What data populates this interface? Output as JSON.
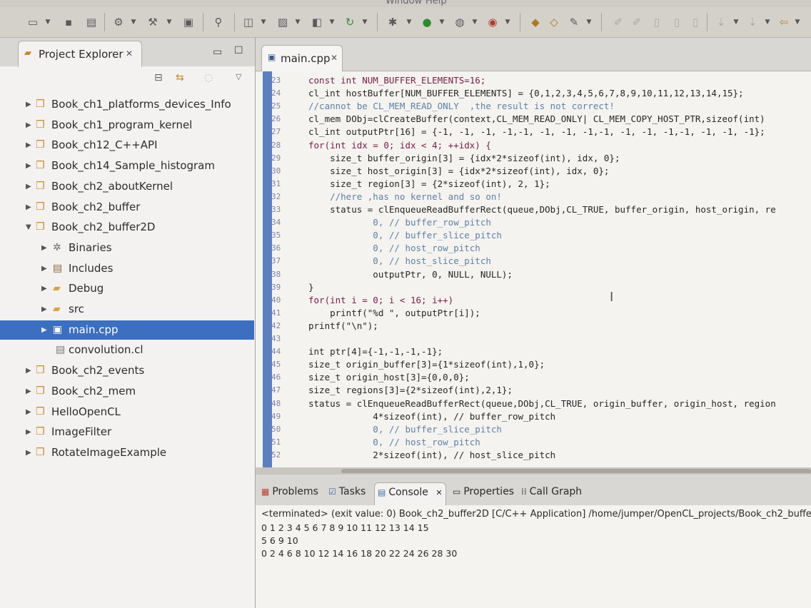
{
  "menubar": {
    "items": [
      "Window",
      "Help"
    ]
  },
  "toolbar": {
    "icons": [
      "new-icon",
      "save-icon",
      "print-icon",
      "build-icon",
      "hammer-icon",
      "binary-icon",
      "search-icon",
      "new-class-icon",
      "new-folder-icon",
      "new-source-icon",
      "refresh-icon",
      "debug-icon",
      "run-icon",
      "profile-icon",
      "external-tools-icon",
      "open-folder-icon",
      "open-type-icon",
      "edit-icon",
      "annotation-icon",
      "prev-icon",
      "next-icon"
    ]
  },
  "project_explorer": {
    "title": "Project Explorer",
    "tree": [
      {
        "label": "Book_ch1_platforms_devices_Info",
        "level": 0,
        "expanded": false,
        "icon": "project-icon"
      },
      {
        "label": "Book_ch1_program_kernel",
        "level": 0,
        "expanded": false,
        "icon": "project-icon"
      },
      {
        "label": "Book_ch12_C++API",
        "level": 0,
        "expanded": false,
        "icon": "project-icon"
      },
      {
        "label": "Book_ch14_Sample_histogram",
        "level": 0,
        "expanded": false,
        "icon": "project-icon"
      },
      {
        "label": "Book_ch2_aboutKernel",
        "level": 0,
        "expanded": false,
        "icon": "project-icon"
      },
      {
        "label": "Book_ch2_buffer",
        "level": 0,
        "expanded": false,
        "icon": "project-icon"
      },
      {
        "label": "Book_ch2_buffer2D",
        "level": 0,
        "expanded": true,
        "icon": "project-icon"
      },
      {
        "label": "Binaries",
        "level": 1,
        "expanded": false,
        "icon": "binaries-icon"
      },
      {
        "label": "Includes",
        "level": 1,
        "expanded": false,
        "icon": "includes-icon"
      },
      {
        "label": "Debug",
        "level": 1,
        "expanded": false,
        "icon": "folder-icon"
      },
      {
        "label": "src",
        "level": 1,
        "expanded": false,
        "icon": "folder-icon"
      },
      {
        "label": "main.cpp",
        "level": 1,
        "expanded": false,
        "icon": "cpp-file-icon",
        "selected": true
      },
      {
        "label": "convolution.cl",
        "level": 1,
        "icon": "file-icon"
      },
      {
        "label": "Book_ch2_events",
        "level": 0,
        "expanded": false,
        "icon": "project-icon"
      },
      {
        "label": "Book_ch2_mem",
        "level": 0,
        "expanded": false,
        "icon": "project-icon"
      },
      {
        "label": "HelloOpenCL",
        "level": 0,
        "expanded": false,
        "icon": "project-icon"
      },
      {
        "label": "ImageFilter",
        "level": 0,
        "expanded": false,
        "icon": "project-icon"
      },
      {
        "label": "RotateImageExample",
        "level": 0,
        "expanded": false,
        "icon": "project-icon"
      }
    ]
  },
  "editor": {
    "tab_label": "main.cpp",
    "lines": [
      {
        "n": "23",
        "text": "const int NUM_BUFFER_ELEMENTS=16;",
        "style": "kw"
      },
      {
        "n": "24",
        "text": "cl_int hostBuffer[NUM_BUFFER_ELEMENTS] = {0,1,2,3,4,5,6,7,8,9,10,11,12,13,14,15};",
        "style": ""
      },
      {
        "n": "25",
        "text": "//cannot be CL_MEM_READ_ONLY  ,the result is not correct!",
        "style": "comment"
      },
      {
        "n": "26",
        "text": "cl_mem DObj=clCreateBuffer(context,CL_MEM_READ_ONLY| CL_MEM_COPY_HOST_PTR,sizeof(int)",
        "style": ""
      },
      {
        "n": "27",
        "text": "cl_int outputPtr[16] = {-1, -1, -1, -1,-1, -1, -1, -1,-1, -1, -1, -1,-1, -1, -1, -1};",
        "style": ""
      },
      {
        "n": "28",
        "text": "for(int idx = 0; idx < 4; ++idx) {",
        "style": "kw"
      },
      {
        "n": "29",
        "text": "    size_t buffer_origin[3] = {idx*2*sizeof(int), idx, 0};",
        "style": ""
      },
      {
        "n": "30",
        "text": "    size_t host_origin[3] = {idx*2*sizeof(int), idx, 0};",
        "style": ""
      },
      {
        "n": "31",
        "text": "    size_t region[3] = {2*sizeof(int), 2, 1};",
        "style": ""
      },
      {
        "n": "32",
        "text": "    //here ,has no kernel and so on!",
        "style": "comment"
      },
      {
        "n": "33",
        "text": "    status = clEnqueueReadBufferRect(queue,DObj,CL_TRUE, buffer_origin, host_origin, re",
        "style": ""
      },
      {
        "n": "34",
        "text": "            0, // buffer_row_pitch",
        "style": "comment"
      },
      {
        "n": "35",
        "text": "            0, // buffer_slice_pitch",
        "style": "comment"
      },
      {
        "n": "36",
        "text": "            0, // host_row_pitch",
        "style": "comment"
      },
      {
        "n": "37",
        "text": "            0, // host_slice_pitch",
        "style": "comment"
      },
      {
        "n": "38",
        "text": "            outputPtr, 0, NULL, NULL);",
        "style": ""
      },
      {
        "n": "39",
        "text": "}",
        "style": ""
      },
      {
        "n": "40",
        "text": "for(int i = 0; i < 16; i++)",
        "style": "kw"
      },
      {
        "n": "41",
        "text": "    printf(\"%d \", outputPtr[i]);",
        "style": ""
      },
      {
        "n": "42",
        "text": "printf(\"\\n\");",
        "style": ""
      },
      {
        "n": "43",
        "text": "",
        "style": ""
      },
      {
        "n": "44",
        "text": "int ptr[4]={-1,-1,-1,-1};",
        "style": ""
      },
      {
        "n": "45",
        "text": "size_t origin_buffer[3]={1*sizeof(int),1,0};",
        "style": ""
      },
      {
        "n": "46",
        "text": "size_t origin_host[3]={0,0,0};",
        "style": ""
      },
      {
        "n": "47",
        "text": "size_t regions[3]={2*sizeof(int),2,1};",
        "style": ""
      },
      {
        "n": "48",
        "text": "status = clEnqueueReadBufferRect(queue,DObj,CL_TRUE, origin_buffer, origin_host, region",
        "style": ""
      },
      {
        "n": "49",
        "text": "            4*sizeof(int), // buffer_row_pitch",
        "style": ""
      },
      {
        "n": "50",
        "text": "            0, // buffer_slice_pitch",
        "style": "comment"
      },
      {
        "n": "51",
        "text": "            0, // host_row_pitch",
        "style": "comment"
      },
      {
        "n": "52",
        "text": "            2*sizeof(int), // host_slice_pitch",
        "style": ""
      }
    ]
  },
  "bottom_panel": {
    "tabs": [
      {
        "label": "Problems",
        "icon": "problems-icon",
        "active": false
      },
      {
        "label": "Tasks",
        "icon": "tasks-icon",
        "active": false
      },
      {
        "label": "Console",
        "icon": "console-icon",
        "active": true
      },
      {
        "label": "Properties",
        "icon": "properties-icon",
        "active": false
      },
      {
        "label": "Call Graph",
        "icon": "call-graph-icon",
        "active": false
      }
    ],
    "terminated_line": "<terminated> (exit value: 0) Book_ch2_buffer2D [C/C++ Application] /home/jumper/OpenCL_projects/Book_ch2_buffe",
    "output": [
      "0 1 2 3 4 5 6 7 8 9 10 11 12 13 14 15",
      "5 6 9 10",
      "0 2 4 6 8 10 12 14 16 18 20 22 24 26 28 30"
    ]
  }
}
